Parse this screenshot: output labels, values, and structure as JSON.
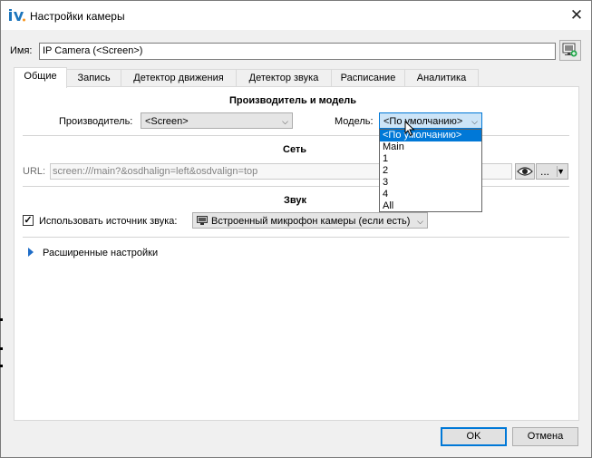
{
  "window": {
    "title": "Настройки камеры",
    "close_label": "✕"
  },
  "name_field": {
    "label": "Имя:",
    "value": "IP Camera (<Screen>)"
  },
  "tabs": [
    {
      "label": "Общие"
    },
    {
      "label": "Запись"
    },
    {
      "label": "Детектор движения"
    },
    {
      "label": "Детектор звука"
    },
    {
      "label": "Расписание"
    },
    {
      "label": "Аналитика"
    }
  ],
  "manufacturer_section": {
    "title": "Производитель и модель",
    "manufacturer_label": "Производитель:",
    "manufacturer_value": "<Screen>",
    "model_label": "Модель:",
    "model_value": "<По умолчанию>",
    "model_options": [
      "<По умолчанию>",
      "Main",
      "1",
      "2",
      "3",
      "4",
      "All"
    ]
  },
  "network_section": {
    "title": "Сеть",
    "url_label": "URL:",
    "url_value": "screen:///main?&osdhalign=left&osdvalign=top",
    "more_label": "..."
  },
  "sound_section": {
    "title": "Звук",
    "use_source_label": "Использовать источник звука:",
    "use_source_checked": true,
    "source_value": "Встроенный микрофон камеры (если есть)"
  },
  "advanced": {
    "label": "Расширенные настройки"
  },
  "footer": {
    "ok_label": "OK",
    "cancel_label": "Отмена"
  },
  "colors": {
    "accent": "#0078d7",
    "selection": "#0078d7"
  }
}
